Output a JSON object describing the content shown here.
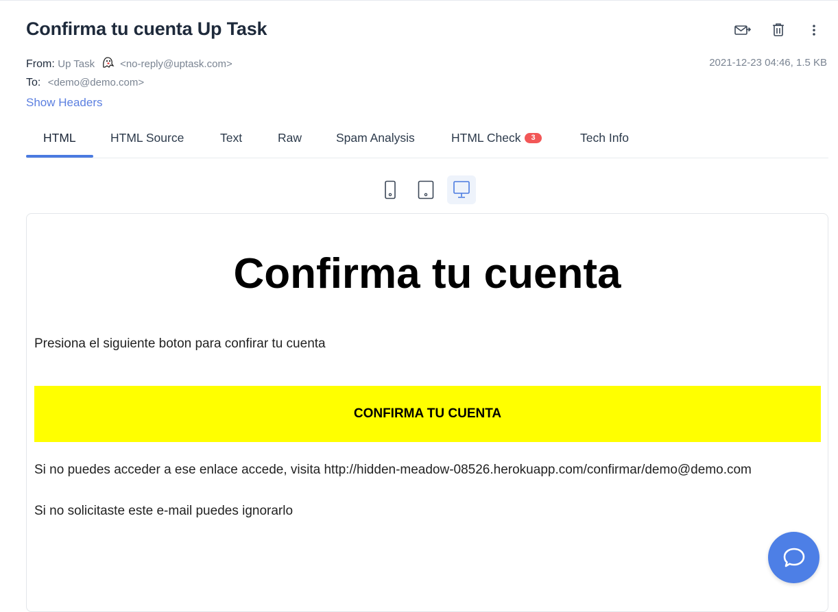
{
  "email": {
    "subject": "Confirma tu cuenta Up Task",
    "from_label": "From:",
    "from_name": "Up Task",
    "from_address": "<no-reply@uptask.com>",
    "to_label": "To:",
    "to_address": "<demo@demo.com>",
    "date_size": "2021-12-23 04:46, 1.5 KB",
    "show_headers": "Show Headers"
  },
  "tabs": [
    {
      "label": "HTML",
      "active": true
    },
    {
      "label": "HTML Source"
    },
    {
      "label": "Text"
    },
    {
      "label": "Raw"
    },
    {
      "label": "Spam Analysis"
    },
    {
      "label": "HTML Check",
      "badge": "3"
    },
    {
      "label": "Tech Info"
    }
  ],
  "icons": {
    "forward": "forward-mail-icon",
    "delete": "trash-icon",
    "more": "more-vertical-icon",
    "mobile": "mobile-device-icon",
    "tablet": "tablet-device-icon",
    "desktop": "desktop-device-icon",
    "chat": "chat-bubble-icon"
  },
  "preview": {
    "heading": "Confirma tu cuenta",
    "intro": "Presiona el siguiente boton para confirar tu cuenta",
    "button_label": "CONFIRMA TU CUENTA",
    "fallback": "Si no puedes acceder a ese enlace accede, visita http://hidden-meadow-08526.herokuapp.com/confirmar/demo@demo.com",
    "ignore": "Si no solicitaste este e-mail puedes ignorarlo"
  },
  "colors": {
    "accent": "#4a7ae0",
    "badge": "#f25757",
    "button_bg": "#ffff00",
    "chat": "#4d7fe6"
  }
}
